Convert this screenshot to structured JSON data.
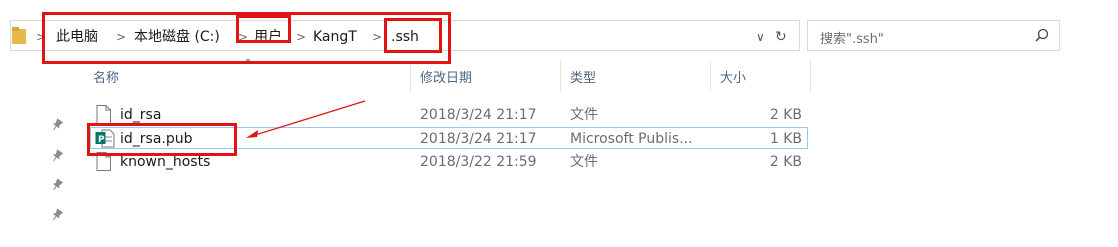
{
  "breadcrumb": {
    "items": [
      "此电脑",
      "本地磁盘 (C:)",
      "用户",
      "KangT",
      ".ssh"
    ],
    "separator": ">",
    "dropdown_glyph": "∨",
    "refresh_glyph": "↻"
  },
  "search": {
    "placeholder": "搜索\".ssh\""
  },
  "columns": {
    "name": "名称",
    "date": "修改日期",
    "type": "类型",
    "size": "大小"
  },
  "files": [
    {
      "name": "id_rsa",
      "date": "2018/3/24 21:17",
      "type": "文件",
      "size": "2 KB",
      "icon": "blank-file-icon"
    },
    {
      "name": "id_rsa.pub",
      "date": "2018/3/24 21:17",
      "type": "Microsoft Publis...",
      "size": "1 KB",
      "icon": "publisher-file-icon",
      "selected": true
    },
    {
      "name": "known_hosts",
      "date": "2018/3/22 21:59",
      "type": "文件",
      "size": "2 KB",
      "icon": "blank-file-icon"
    }
  ],
  "colors": {
    "highlight": "#e11414",
    "header_text": "#4d6785",
    "selection_border": "#99c7f1",
    "publisher_green": "#077568"
  }
}
